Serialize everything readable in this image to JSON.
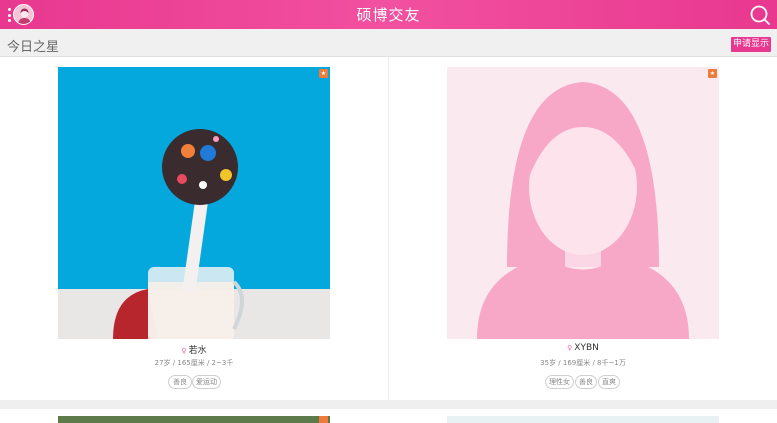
{
  "header": {
    "title": "硕博交友"
  },
  "section": {
    "title": "今日之星",
    "apply_label": "申请显示"
  },
  "cards": [
    {
      "badge": "★",
      "gender_symbol": "♀",
      "name": "若水",
      "meta": "27岁 / 165厘米 / 2~3千",
      "tags": [
        "善良",
        "爱运动"
      ]
    },
    {
      "badge": "★",
      "gender_symbol": "♀",
      "name": "XYBN",
      "meta": "35岁 / 169厘米 / 8千~1万",
      "tags": [
        "理性女",
        "善良",
        "直爽"
      ]
    }
  ],
  "icons": {
    "menu": "more-vertical-icon",
    "avatar": "user-avatar",
    "search": "search-icon",
    "star": "star-icon",
    "gender": "female-icon"
  },
  "colors": {
    "brand": "#e8388f",
    "badge": "#f07a3a",
    "photo_bg_1": "#05a8dd",
    "photo_bg_2": "#fbe9f0"
  }
}
